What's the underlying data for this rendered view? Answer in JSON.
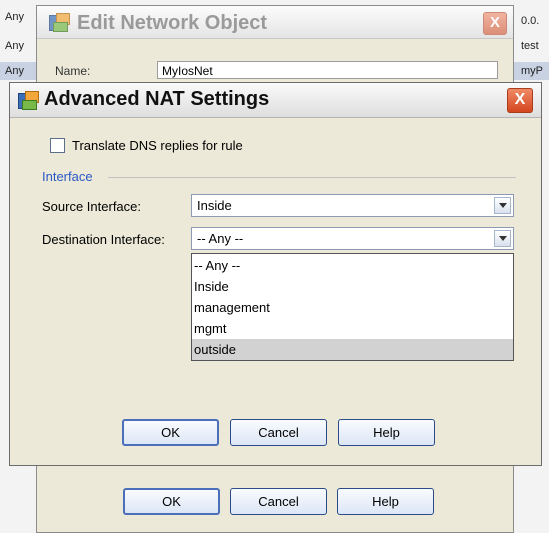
{
  "background_table": {
    "left_column": [
      "Any",
      "Any",
      "Any"
    ],
    "right_column": [
      "0.0.",
      "test",
      "myP"
    ]
  },
  "edit_network_object": {
    "title": "Edit Network Object",
    "close_label": "X",
    "name_label": "Name:",
    "name_value": "MyIosNet",
    "ok_label": "OK",
    "cancel_label": "Cancel",
    "help_label": "Help"
  },
  "advanced_nat": {
    "title": "Advanced NAT Settings",
    "close_label": "X",
    "translate_dns": {
      "label": "Translate DNS replies for rule",
      "checked": false
    },
    "interface_group_label": "Interface",
    "source_interface": {
      "label": "Source Interface:",
      "value": "Inside"
    },
    "destination_interface": {
      "label": "Destination Interface:",
      "value": "-- Any --",
      "open": true,
      "options": [
        "-- Any --",
        "Inside",
        "management",
        "mgmt",
        "outside"
      ],
      "highlighted_option": "outside"
    },
    "ok_label": "OK",
    "cancel_label": "Cancel",
    "help_label": "Help"
  },
  "colors": {
    "group_label": "#2a58c6",
    "dialog_background": "#ece9d8",
    "highlight_option": "#d2d2d2",
    "close_button": "#d4451e"
  },
  "icons": {
    "app_icon": "asdm-app-icon",
    "close_icon": "close-x-icon",
    "dropdown_icon": "chevron-down-icon"
  }
}
